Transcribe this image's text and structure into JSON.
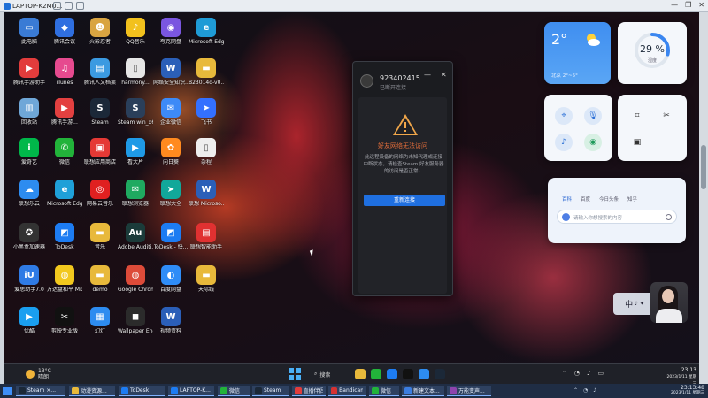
{
  "viewer": {
    "title": "LAPTOP-K2MU...",
    "controls": [
      "—",
      "❐",
      "✕"
    ]
  },
  "desktop_icons": [
    {
      "label": "此电脑",
      "icon": "computer-icon",
      "color": "#3a7bd5",
      "char": "▭"
    },
    {
      "label": "腾讯会议",
      "icon": "tencent-meeting-icon",
      "color": "#2f6fe0",
      "char": "◆"
    },
    {
      "label": "火影忍者",
      "icon": "game-icon",
      "color": "#d9a441",
      "char": "☻"
    },
    {
      "label": "QQ音乐",
      "icon": "qq-music-icon",
      "color": "#f2c11d",
      "char": "♪"
    },
    {
      "label": "夸克网盘",
      "icon": "quark-icon",
      "color": "#7a56e0",
      "char": "◉"
    },
    {
      "label": "Microsoft Edge",
      "icon": "edge-icon",
      "color": "#1f9bd6",
      "char": "e"
    },
    {
      "label": "腾讯手游助手",
      "icon": "tencent-game-helper-icon",
      "color": "#e23c3c",
      "char": "▶"
    },
    {
      "label": "iTunes",
      "icon": "itunes-icon",
      "color": "#e64a8f",
      "char": "♫"
    },
    {
      "label": "腾讯人文档案",
      "icon": "document-icon",
      "color": "#3b9ae1",
      "char": "▤"
    },
    {
      "label": "harmony...",
      "icon": "file-icon",
      "color": "#e6e6e6",
      "char": "▯"
    },
    {
      "label": "网络安全知识...",
      "icon": "word-icon",
      "color": "#2b5fb8",
      "char": "W"
    },
    {
      "label": "B23014d-v0...",
      "icon": "folder-icon",
      "color": "#e8b93b",
      "char": "▬"
    },
    {
      "label": "回收站",
      "icon": "recycle-bin-icon",
      "color": "#6fa7d8",
      "char": "▥"
    },
    {
      "label": "腾讯手游...",
      "icon": "tencent-mobile-icon",
      "color": "#e34040",
      "char": "▶"
    },
    {
      "label": "Steam",
      "icon": "steam-icon",
      "color": "#1b2838",
      "char": "S"
    },
    {
      "label": "Steam win_x64...",
      "icon": "steam-installer-icon",
      "color": "#2a3f5a",
      "char": "S"
    },
    {
      "label": "企业微信",
      "icon": "wecom-icon",
      "color": "#3d8af7",
      "char": "✉"
    },
    {
      "label": "飞书",
      "icon": "feishu-icon",
      "color": "#3370ff",
      "char": "➤"
    },
    {
      "label": "爱奇艺",
      "icon": "iqiyi-icon",
      "color": "#00b84a",
      "char": "i"
    },
    {
      "label": "微信",
      "icon": "wechat-icon",
      "color": "#22b33a",
      "char": "✆"
    },
    {
      "label": "联想应用商店",
      "icon": "lenovo-store-icon",
      "color": "#e53935",
      "char": "▣"
    },
    {
      "label": "看大片",
      "icon": "video-icon",
      "color": "#1f9ae6",
      "char": "▶"
    },
    {
      "label": "向日葵",
      "icon": "sunflower-icon",
      "color": "#ff8a1f",
      "char": "✿"
    },
    {
      "label": "杂程",
      "icon": "file-icon",
      "color": "#eeeeee",
      "char": "▯"
    },
    {
      "label": "联想乐云",
      "icon": "lenovo-cloud-icon",
      "color": "#2d8cf0",
      "char": "☁"
    },
    {
      "label": "Microsoft Edge",
      "icon": "edge-icon",
      "color": "#1fa0d8",
      "char": "e"
    },
    {
      "label": "网易云音乐",
      "icon": "netease-music-icon",
      "color": "#e02020",
      "char": "◎"
    },
    {
      "label": "联想浏览器",
      "icon": "lenovo-browser-icon",
      "color": "#1faa60",
      "char": "✉"
    },
    {
      "label": "联想大全",
      "icon": "lenovo-all-icon",
      "color": "#12a89a",
      "char": "➤"
    },
    {
      "label": "联想 Microso...",
      "icon": "word-icon",
      "color": "#2b5fb8",
      "char": "W"
    },
    {
      "label": "小黑盒加速器",
      "icon": "speedup-icon",
      "color": "#333333",
      "char": "✪"
    },
    {
      "label": "ToDesk",
      "icon": "todesk-icon",
      "color": "#1d7cf2",
      "char": "◩"
    },
    {
      "label": "音乐",
      "icon": "folder-icon",
      "color": "#e8b93b",
      "char": "▬"
    },
    {
      "label": "Adobe Auditi...",
      "icon": "audition-icon",
      "color": "#1b3b3a",
      "char": "Au"
    },
    {
      "label": "ToDesk - 快...",
      "icon": "todesk-icon",
      "color": "#1d7cf2",
      "char": "◩"
    },
    {
      "label": "联想智能助手",
      "icon": "lenovo-assistant-icon",
      "color": "#e03131",
      "char": "▤"
    },
    {
      "label": "爱思助手7.0",
      "icon": "aisi-icon",
      "color": "#2f7be5",
      "char": "iU"
    },
    {
      "label": "万达盘和平 Mixdown 1",
      "icon": "mixdown-icon",
      "color": "#f2c81e",
      "char": "◍"
    },
    {
      "label": "demo",
      "icon": "folder-icon",
      "color": "#e8b93b",
      "char": "▬"
    },
    {
      "label": "Google Chrome",
      "icon": "chrome-icon",
      "color": "#dd4b39",
      "char": "◍"
    },
    {
      "label": "百度网盘",
      "icon": "baidu-pan-icon",
      "color": "#2f8df7",
      "char": "◐"
    },
    {
      "label": "天际线",
      "icon": "folder-icon",
      "color": "#e8b93b",
      "char": "▬"
    },
    {
      "label": "优酷",
      "icon": "youku-icon",
      "color": "#1a9ff0",
      "char": "▶"
    },
    {
      "label": "剪映专业版",
      "icon": "capcut-icon",
      "color": "#111111",
      "char": "✂"
    },
    {
      "label": "幻灯",
      "icon": "slides-icon",
      "color": "#2d8cf0",
      "char": "▦"
    },
    {
      "label": "Wallpaper Enginee...",
      "icon": "wallpaper-engine-icon",
      "color": "#2b2b2b",
      "char": "◼"
    },
    {
      "label": "视频资料",
      "icon": "word-icon",
      "color": "#2b5fb8",
      "char": "W"
    }
  ],
  "dialog": {
    "id_text": "923402415",
    "status_text": "已断开连接",
    "minimize": "—",
    "close": "✕",
    "title": "好友网络无法访问",
    "message": "此远程设备的网络为未知代理或连接中断状态，请检查Steam 好友服务器的访问是否正常。",
    "button_label": "重新连接"
  },
  "weather": {
    "temperature": "2°",
    "city": "北京  2°~5°"
  },
  "humidity": {
    "value": "29 %",
    "label": "湿度",
    "fraction": 0.29
  },
  "quick_actions": [
    "location-icon",
    "microphone-icon",
    "volume-icon",
    "eye-icon"
  ],
  "quick_tools": [
    "crop-icon",
    "scissors-icon",
    "record-icon"
  ],
  "search_widget": {
    "tabs": [
      "百科",
      "百度",
      "今日头条",
      "知乎"
    ],
    "active_tab": 0,
    "placeholder": "请输入你想搜索的内容"
  },
  "ime": {
    "text": "中",
    "extra": "♪ ✦"
  },
  "inner_taskbar": {
    "weather_temp": "13°C",
    "weather_desc": "晴朗",
    "search_label": "搜索",
    "clock_time": "23:13",
    "clock_date": "2023/1/11 星期三"
  },
  "host_taskbar": {
    "items": [
      {
        "label": "Steam ×...",
        "color": "#1b2838"
      },
      {
        "label": "动漫资源...",
        "color": "#e8b93b"
      },
      {
        "label": "ToDesk",
        "color": "#1d7cf2"
      },
      {
        "label": "LAPTOP-K...",
        "color": "#1d7cf2"
      },
      {
        "label": "微信",
        "color": "#22b33a"
      },
      {
        "label": "Steam",
        "color": "#1b2838"
      },
      {
        "label": "直播伴侣",
        "color": "#e23c3c"
      },
      {
        "label": "Bandicam",
        "color": "#d53232"
      },
      {
        "label": "微信",
        "color": "#22b33a"
      },
      {
        "label": "新建文本...",
        "color": "#3b7de0"
      },
      {
        "label": "万能变声...",
        "color": "#8e44ad"
      }
    ],
    "clock_time": "23:13:48",
    "clock_date": "2023/1/11 星期三"
  }
}
